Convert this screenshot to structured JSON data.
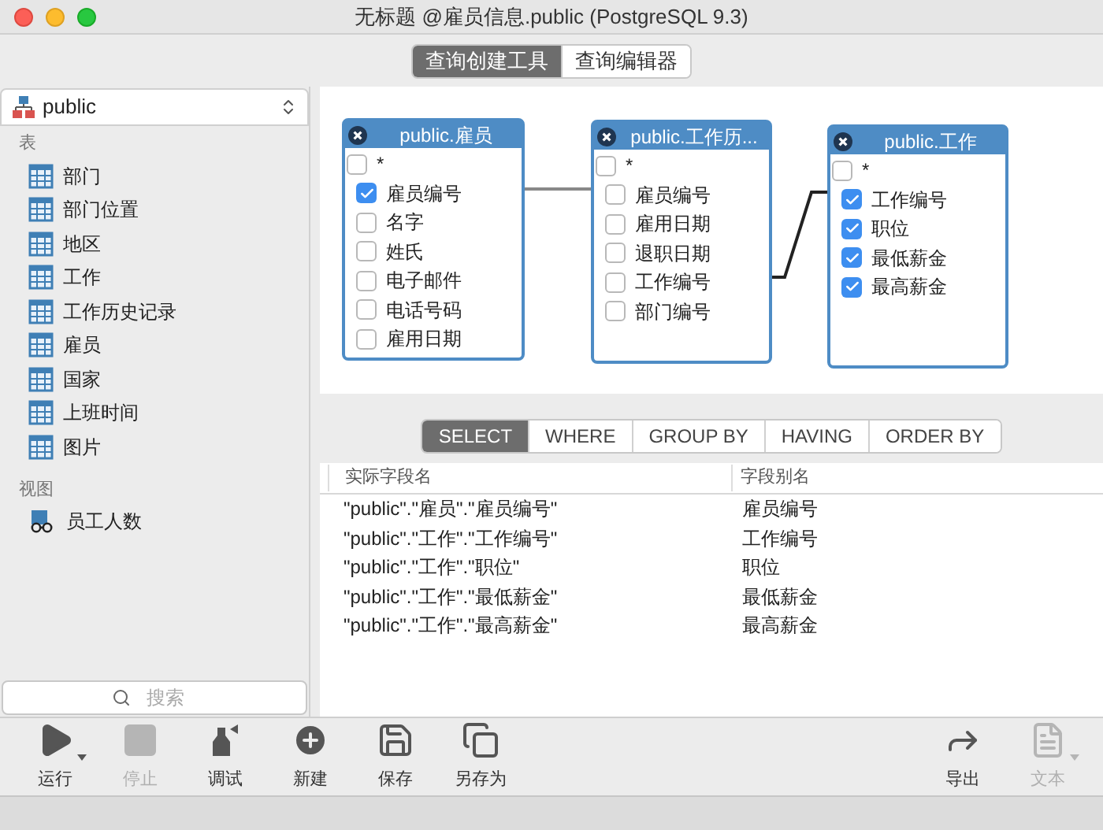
{
  "window": {
    "title": "无标题 @雇员信息.public (PostgreSQL 9.3)"
  },
  "mode_tabs": [
    {
      "label": "查询创建工具",
      "selected": true
    },
    {
      "label": "查询编辑器",
      "selected": false
    }
  ],
  "sidebar": {
    "schema": "public",
    "sections": [
      {
        "title": "表",
        "kind": "table",
        "items": [
          "部门",
          "部门位置",
          "地区",
          "工作",
          "工作历史记录",
          "雇员",
          "国家",
          "上班时间",
          "图片"
        ]
      },
      {
        "title": "视图",
        "kind": "view",
        "items": [
          "员工人数"
        ]
      }
    ],
    "search": {
      "placeholder": "搜索"
    }
  },
  "diagram": {
    "tables": [
      {
        "title": "public.雇员",
        "fields": [
          {
            "name": "*",
            "checked": false
          },
          {
            "name": "雇员编号",
            "checked": true
          },
          {
            "name": "名字",
            "checked": false
          },
          {
            "name": "姓氏",
            "checked": false
          },
          {
            "name": "电子邮件",
            "checked": false
          },
          {
            "name": "电话号码",
            "checked": false
          },
          {
            "name": "雇用日期",
            "checked": false
          }
        ]
      },
      {
        "title": "public.工作历...",
        "fields": [
          {
            "name": "*",
            "checked": false
          },
          {
            "name": "雇员编号",
            "checked": false
          },
          {
            "name": "雇用日期",
            "checked": false
          },
          {
            "name": "退职日期",
            "checked": false
          },
          {
            "name": "工作编号",
            "checked": false
          },
          {
            "name": "部门编号",
            "checked": false
          }
        ]
      },
      {
        "title": "public.工作",
        "fields": [
          {
            "name": "*",
            "checked": false
          },
          {
            "name": "工作编号",
            "checked": true
          },
          {
            "name": "职位",
            "checked": true
          },
          {
            "name": "最低薪金",
            "checked": true
          },
          {
            "name": "最高薪金",
            "checked": true
          }
        ]
      }
    ]
  },
  "clause_tabs": [
    {
      "label": "SELECT",
      "selected": true
    },
    {
      "label": "WHERE",
      "selected": false
    },
    {
      "label": "GROUP BY",
      "selected": false
    },
    {
      "label": "HAVING",
      "selected": false
    },
    {
      "label": "ORDER BY",
      "selected": false
    }
  ],
  "table": {
    "columns": [
      "实际字段名",
      "字段别名"
    ],
    "rows": [
      [
        "\"public\".\"雇员\".\"雇员编号\"",
        "雇员编号"
      ],
      [
        "\"public\".\"工作\".\"工作编号\"",
        "工作编号"
      ],
      [
        "\"public\".\"工作\".\"职位\"",
        "职位"
      ],
      [
        "\"public\".\"工作\".\"最低薪金\"",
        "最低薪金"
      ],
      [
        "\"public\".\"工作\".\"最高薪金\"",
        "最高薪金"
      ]
    ]
  },
  "toolbar": {
    "left": [
      {
        "kind": "run",
        "label": "运行",
        "disabled": false
      },
      {
        "kind": "stop",
        "label": "停止",
        "disabled": true
      },
      {
        "kind": "debug",
        "label": "调试",
        "disabled": false
      },
      {
        "kind": "new",
        "label": "新建",
        "disabled": false
      },
      {
        "kind": "save",
        "label": "保存",
        "disabled": false
      },
      {
        "kind": "save_as",
        "label": "另存为",
        "disabled": false
      }
    ],
    "right": [
      {
        "kind": "export",
        "label": "导出",
        "disabled": false
      },
      {
        "kind": "text",
        "label": "文本",
        "disabled": true
      }
    ]
  }
}
